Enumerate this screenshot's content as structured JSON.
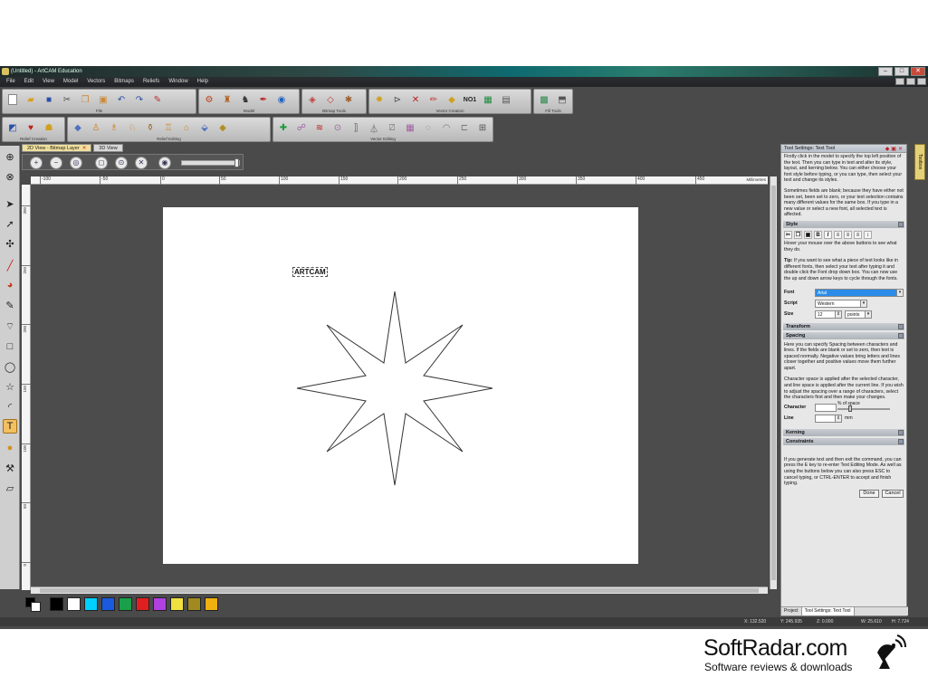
{
  "window": {
    "title": "(Untitled) - ArtCAM Education"
  },
  "menu": [
    "File",
    "Edit",
    "View",
    "Model",
    "Vectors",
    "Bitmaps",
    "Reliefs",
    "Window",
    "Help"
  ],
  "toolbar_groups": {
    "file": "File",
    "model": "Model",
    "bitmap_tools": "Bitmap Tools",
    "vector_creation": "Vector Creation",
    "fill_tools": "Fill Tools",
    "relief_creation": "Relief Creation",
    "relief_editing": "Relief Editing",
    "vector_editing": "Vector Editing"
  },
  "view_tabs": [
    {
      "label": "2D View - Bitmap Layer",
      "active": true
    },
    {
      "label": "3D View",
      "active": false
    }
  ],
  "ruler": {
    "units": "Millimetres",
    "h_ticks": [
      "-100",
      "-50",
      "0",
      "50",
      "100",
      "150",
      "200",
      "250",
      "300",
      "350",
      "400",
      "450"
    ],
    "v_ticks": [
      "300",
      "250",
      "200",
      "150",
      "100",
      "50",
      "0"
    ]
  },
  "canvas": {
    "text_object": "ARTCAM"
  },
  "palette": {
    "colors": [
      "#000000",
      "#ffffff",
      "#00d0ff",
      "#1a5adf",
      "#1aa04a",
      "#e02020",
      "#b040e0",
      "#f0e040",
      "#a08a20",
      "#f0b010"
    ]
  },
  "panel": {
    "title": "Tool Settings: Text Tool",
    "intro": "Firstly click in the model to specify the top left position of the text. Then you can type in text and alter its style, layout, and kerning below. You can either choose your font style before typing, or you can type, then select your text and change its styles.",
    "blank_note": "Sometimes fields are blank; because they have either not been set, been set to zero, or your text selection contains many different values for the same box. If you type in a new value or select a new font, all selected text is affected.",
    "style_section": "Style",
    "hover_note": "Hover your mouse over the above buttons to see what they do.",
    "tip_label": "Tip:",
    "tip": "If you want to see what a piece of text looks like in different fonts, then select your text after typing it and double click the Font drop down box. You can now use the up and down arrow keys to cycle through the fonts.",
    "font_label": "Font",
    "font_value": "Arial",
    "script_label": "Script",
    "script_value": "Western",
    "size_label": "Size",
    "size_value": "12",
    "size_unit": "points",
    "transform_section": "Transform",
    "spacing_section": "Spacing",
    "spacing_note": "Here you can specify Spacing between characters and lines. If the fields are blank or set to zero, then text is spaced normally. Negative values bring letters and lines closer together and positive values move them further apart.",
    "char_note": "Character space is applied after the selected character, and line space is applied after the current line. If you wish to adjust the spacing over a range of characters, select the characters first and then make your changes.",
    "character_label": "Character",
    "char_unit": "% of space",
    "line_label": "Line",
    "line_unit": "mm",
    "kerning_section": "Kerning",
    "constraints_section": "Constraints",
    "exit_note": "If you generate text and then exit the command, you can press the E key to re-enter Text Editing Mode. As well as using the buttons below you can also press ESC to cancel typing, or CTRL-ENTER to accept and finish typing.",
    "done_label": "Done",
    "cancel_label": "Cancel",
    "tabs": [
      "Project",
      "Tool Settings: Text Tool"
    ]
  },
  "toolbox_tab": "Toolbox",
  "status": {
    "x": "X: 132.520",
    "y": "Y: 245.935",
    "z": "Z: 0.000",
    "w": "W: 25.610",
    "h": "H: 7.724"
  },
  "watermark": {
    "title": "SoftRadar.com",
    "subtitle": "Software reviews & downloads"
  }
}
